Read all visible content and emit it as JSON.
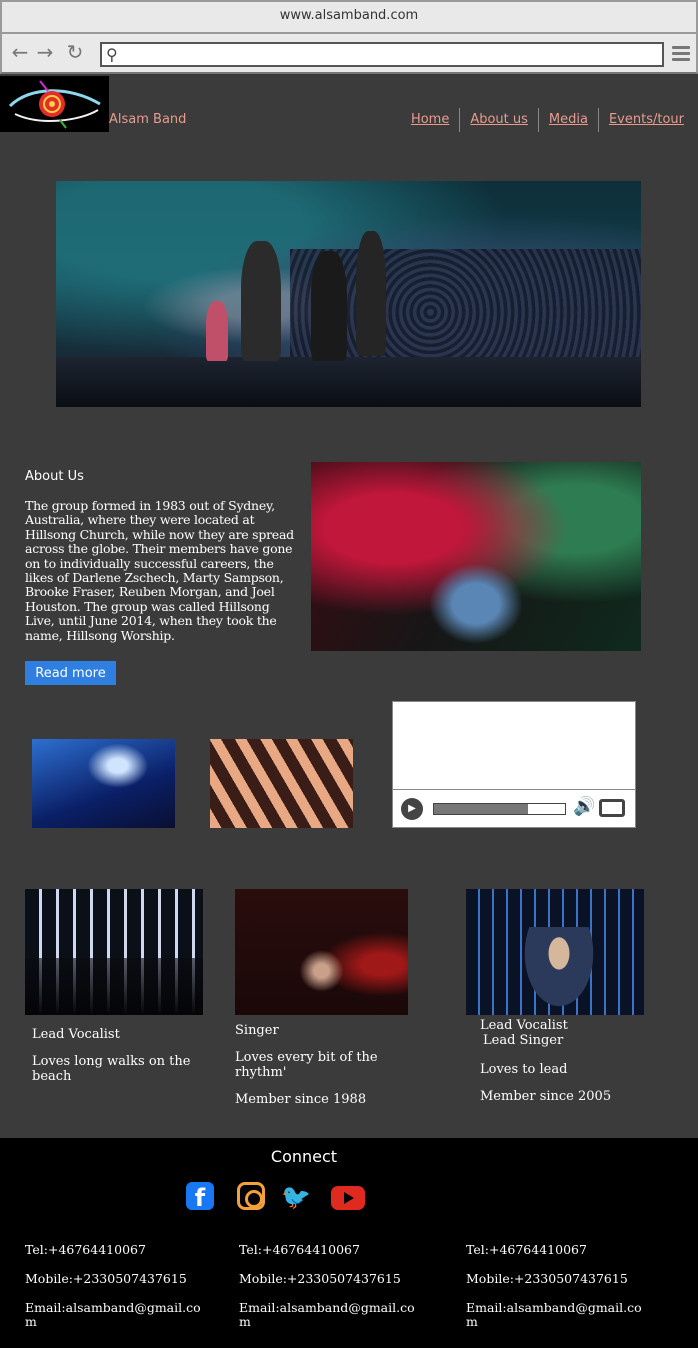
{
  "browser": {
    "url": "www.alsamband.com",
    "address_value": ""
  },
  "header": {
    "brand": "Alsam Band",
    "nav": [
      "Home",
      "About us",
      "Media",
      "Events/tour"
    ]
  },
  "about": {
    "title": "About Us",
    "body": "The group formed in 1983 out of Sydney, Australia, where they were located at Hillsong Church, while now they are spread across the globe. Their members have gone on to individually successful careers, the likes of Darlene Zschech, Marty Sampson, Brooke Fraser, Reuben Morgan, and Joel Houston. The group was called Hillsong Live, until June 2014, when they took the name, Hillsong Worship.",
    "read_more": "Read more"
  },
  "video": {
    "progress": 0.72
  },
  "members": [
    {
      "role": "Lead Vocalist",
      "bio": "Loves long walks on the beach"
    },
    {
      "role": "Singer",
      "bio": "Loves every bit of the rhythm'",
      "since": "Member since 1988"
    },
    {
      "role": "Lead Vocalist",
      "role2": "Lead Singer",
      "bio": "Loves to lead",
      "since": "Member since 2005"
    }
  ],
  "footer": {
    "connect": "Connect",
    "social": [
      "facebook-icon",
      "instagram-icon",
      "twitter-icon",
      "youtube-icon"
    ],
    "contacts": [
      {
        "tel": "Tel:+46764410067",
        "mobile": "Mobile:+2330507437615",
        "email": "Email:alsamband@gmail.com"
      },
      {
        "tel": "Tel:+46764410067",
        "mobile": "Mobile:+2330507437615",
        "email": "Email:alsamband@gmail.com"
      },
      {
        "tel": "Tel:+46764410067",
        "mobile": "Mobile:+2330507437615",
        "email": "Email:alsamband@gmail.com"
      }
    ]
  },
  "colors": {
    "link": "#e79b8d",
    "button": "#2e7fe0",
    "page_bg": "#3b3b3b"
  }
}
